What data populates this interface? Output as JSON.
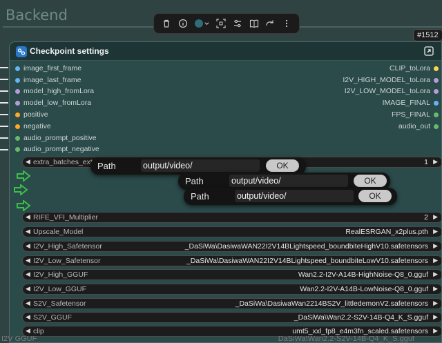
{
  "group": {
    "title": "Backend"
  },
  "toolbar": {
    "icons": [
      "trash-icon",
      "info-icon",
      "color-icon",
      "fit-icon",
      "settings-icon",
      "book-icon",
      "redo-icon",
      "more-icon"
    ],
    "color": "#2d6d7a"
  },
  "node": {
    "id_badge": "#1512",
    "title": "Checkpoint settings",
    "inputs": [
      {
        "label": "image_first_frame",
        "color": "#64b5f6"
      },
      {
        "label": "image_last_frame",
        "color": "#64b5f6"
      },
      {
        "label": "model_high_fromLora",
        "color": "#b39ddb"
      },
      {
        "label": "model_low_fromLora",
        "color": "#b39ddb"
      },
      {
        "label": "positive",
        "color": "#ffa726"
      },
      {
        "label": "negative",
        "color": "#ffa726"
      },
      {
        "label": "audio_prompt_positive",
        "color": "#66bb6a"
      },
      {
        "label": "audio_prompt_negative",
        "color": "#66bb6a"
      }
    ],
    "outputs": [
      {
        "label": "CLIP_toLora",
        "color": "#ffd54f"
      },
      {
        "label": "I2V_HIGH_MODEL_toLora",
        "color": "#b39ddb"
      },
      {
        "label": "I2V_LOW_MODEL_toLora",
        "color": "#b39ddb"
      },
      {
        "label": "IMAGE_FINAL",
        "color": "#64b5f6"
      },
      {
        "label": "FPS_FINAL",
        "color": "#66bb6a"
      },
      {
        "label": "audio_out",
        "color": "#66bb6a"
      }
    ],
    "widgets": {
      "extra_batches": {
        "label": "extra_batches_ext",
        "value": "1"
      },
      "rife": {
        "label": "RIFE_VFI_Multiplier",
        "value": "2"
      },
      "upscale": {
        "label": "Upscale_Model",
        "value": "RealESRGAN_x2plus.pth"
      },
      "i2v_high_st": {
        "label": "I2V_High_Safetensor",
        "value": "_DaSiWa\\DasiwaWAN22I2V14BLightspeed_boundbiteHighV10.safetensors"
      },
      "i2v_low_st": {
        "label": "I2V_Low_Safetensor",
        "value": "_DaSiWa\\DasiwaWAN22I2V14BLightspeed_boundbiteLowV10.safetensors"
      },
      "i2v_high_gguf": {
        "label": "I2V_High_GGUF",
        "value": "Wan2.2-I2V-A14B-HighNoise-Q8_0.gguf"
      },
      "i2v_low_gguf": {
        "label": "I2V_Low_GGUF",
        "value": "Wan2.2-I2V-A14B-LowNoise-Q8_0.gguf"
      },
      "s2v_st": {
        "label": "S2V_Safetensor",
        "value": "_DaSiWa\\DasiwaWan2214BS2V_littledemonV2.safetensors"
      },
      "s2v_gguf": {
        "label": "S2V_GGUF",
        "value": "_DaSiWa\\Wan2.2-S2V-14B-Q4_K_S.gguf"
      },
      "clip": {
        "label": "clip",
        "value": "umt5_xxl_fp8_e4m3fn_scaled.safetensors"
      }
    }
  },
  "popups": [
    {
      "label": "Path",
      "value": "output/video/",
      "ok": "OK"
    },
    {
      "label": "Path",
      "value": "output/video/",
      "ok": "OK"
    },
    {
      "label": "Path",
      "value": "output/video/",
      "ok": "OK"
    }
  ],
  "bottom_ghost": {
    "left": "I2V GGUF",
    "right": "DaSiWa\\Wan2.2-S2V-14B-Q4_K_S.gguf"
  }
}
